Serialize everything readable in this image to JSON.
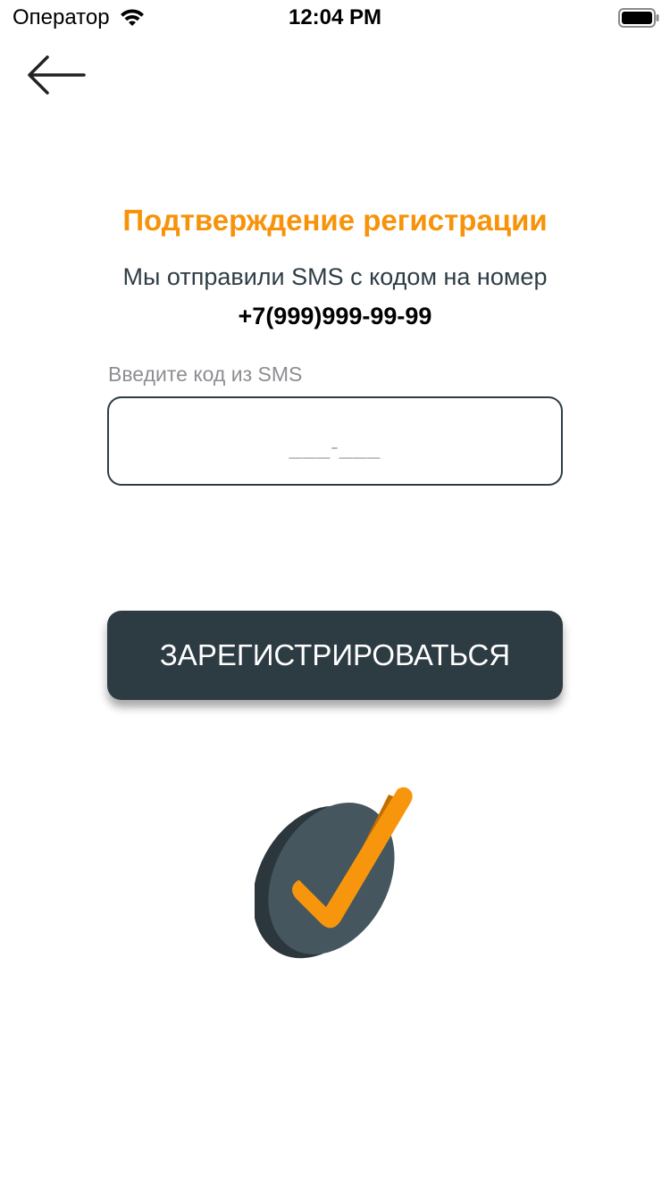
{
  "status_bar": {
    "carrier": "Оператор",
    "time": "12:04 PM",
    "icons": [
      "wifi-icon",
      "battery-icon"
    ]
  },
  "navigation": {
    "back_icon": "arrow-left-icon"
  },
  "main": {
    "title": "Подтверждение регистрации",
    "subtitle": "Мы отправили SMS с кодом на номер",
    "phone_number": "+7(999)999-99-99",
    "code_input": {
      "label": "Введите код из SMS",
      "placeholder": "___-___"
    },
    "register_button_label": "ЗАРЕГИСТРИРОВАТЬСЯ",
    "illustration_icon": "checkmark-badge-icon"
  },
  "colors": {
    "accent": "#f7930a",
    "dark": "#2d3b43",
    "background": "#ffffff"
  }
}
